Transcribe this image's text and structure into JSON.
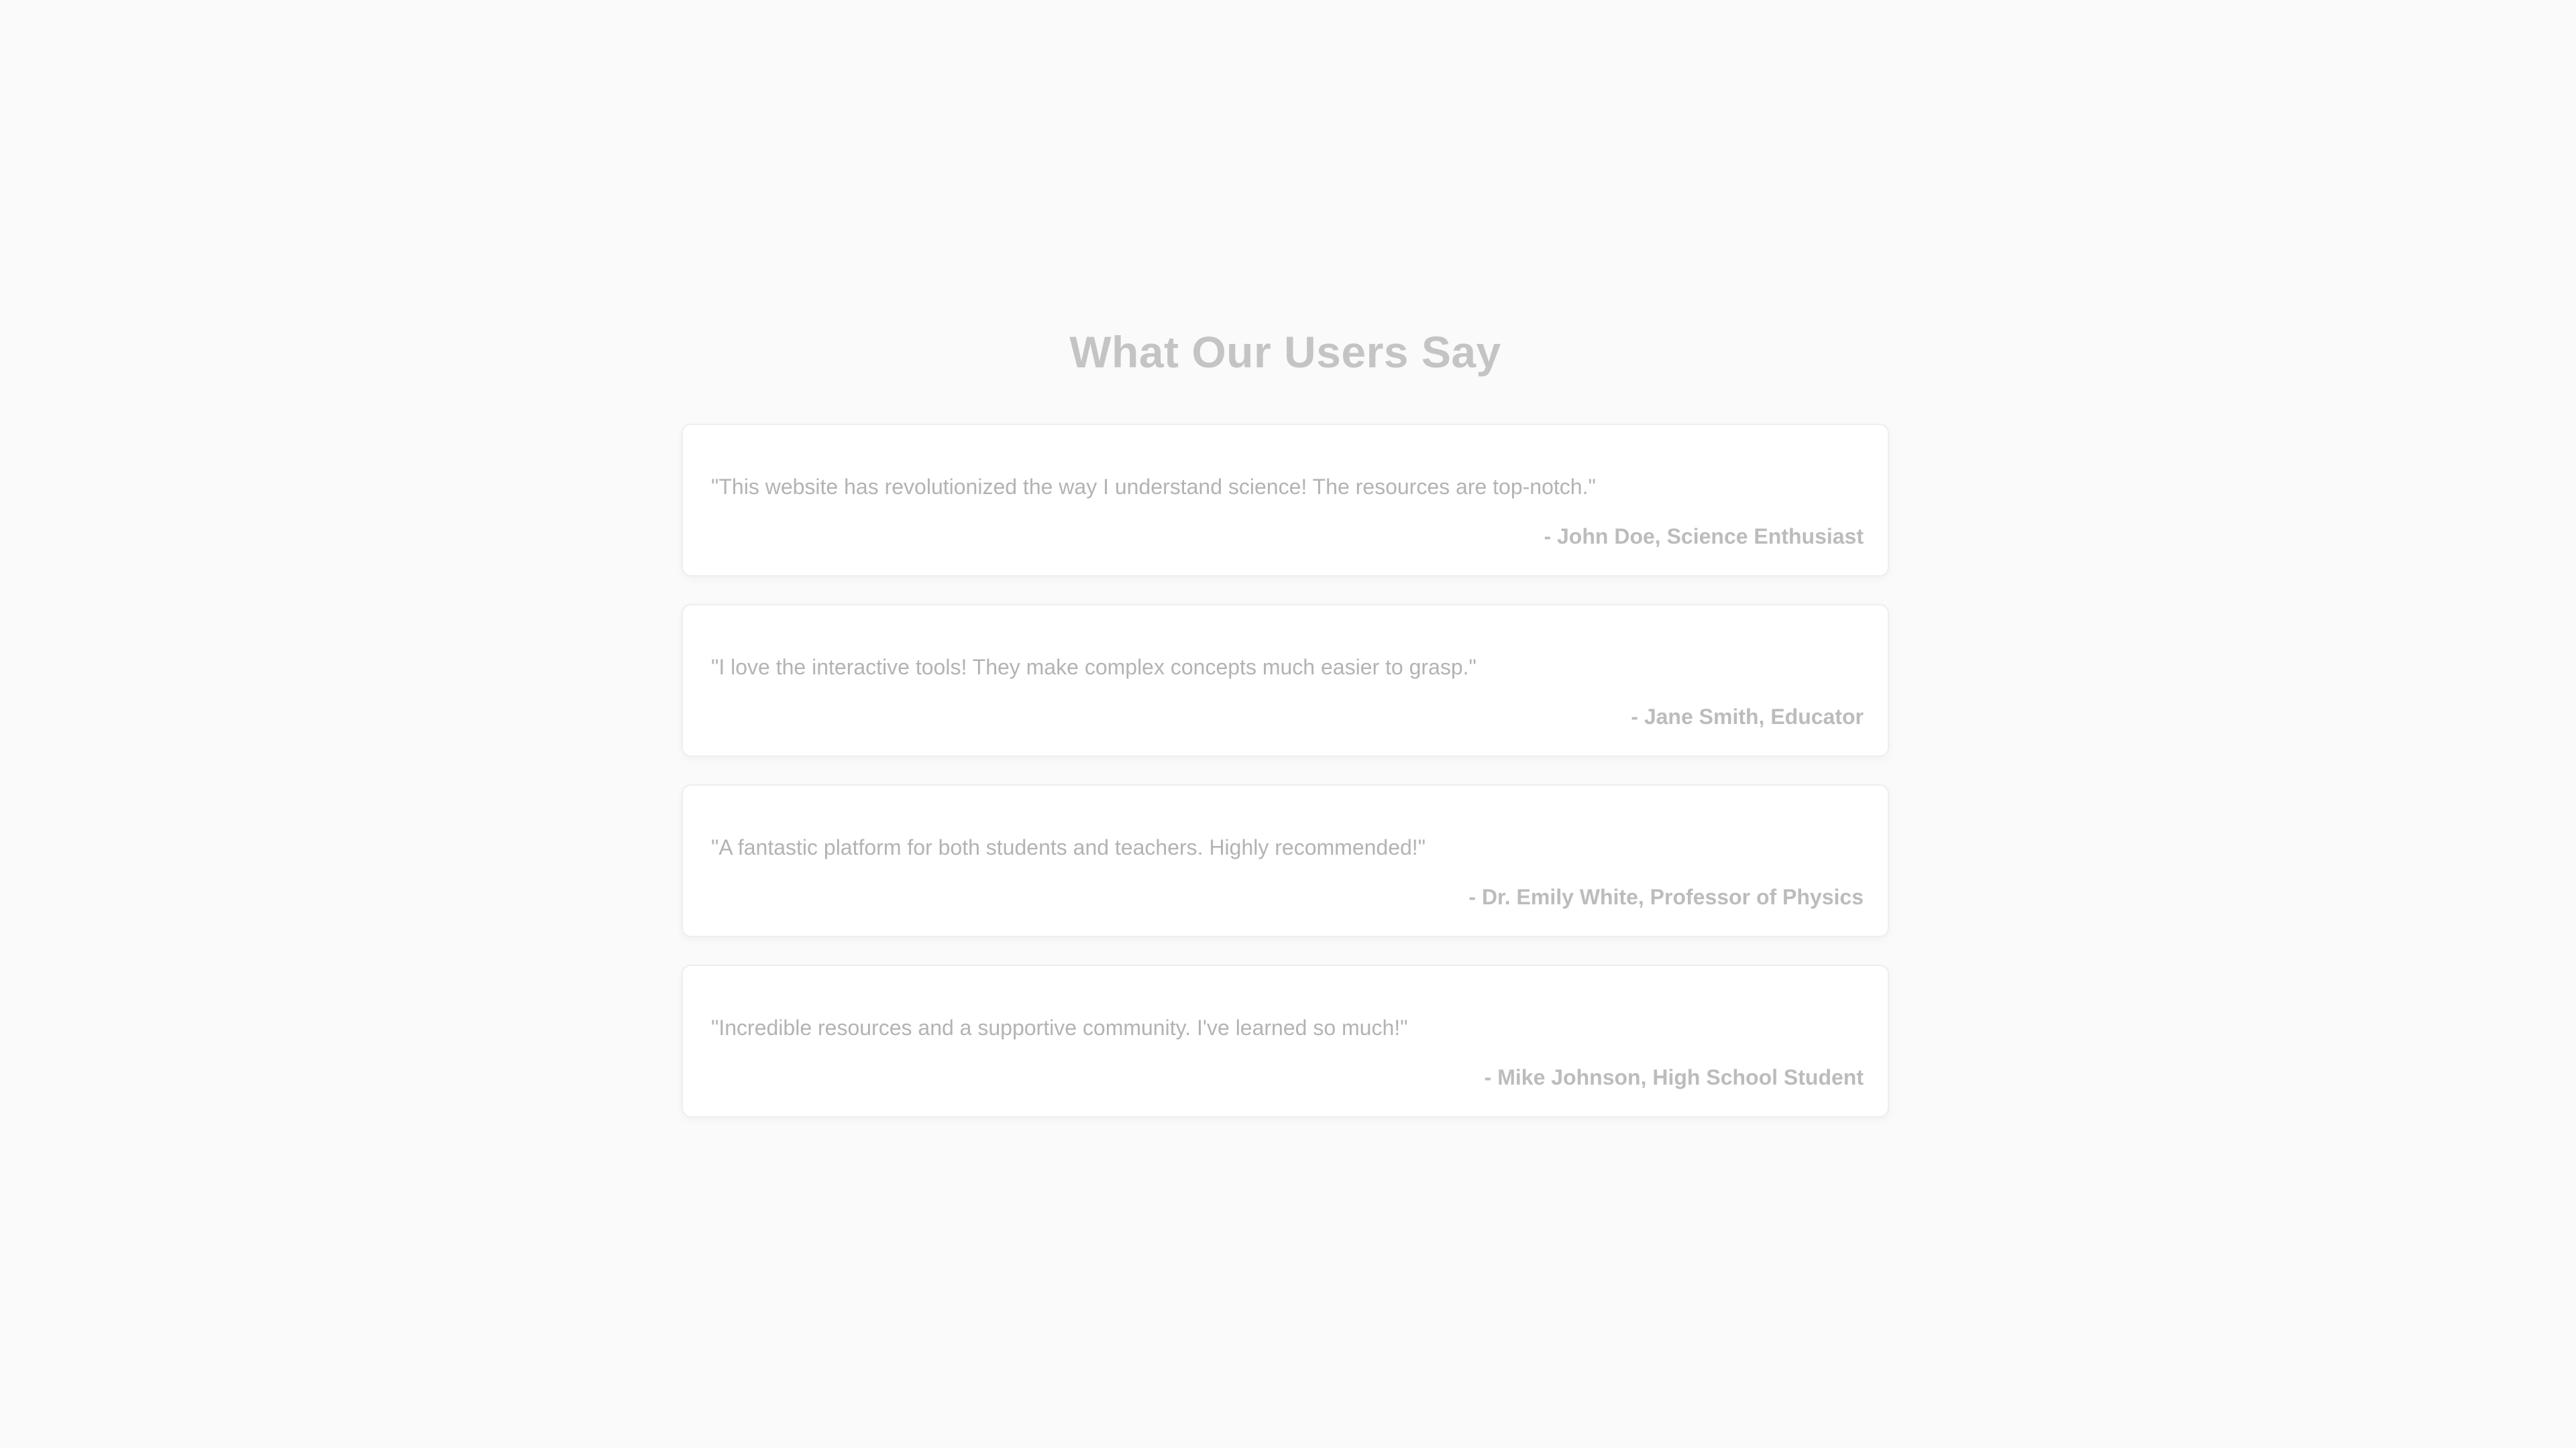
{
  "testimonials_section": {
    "heading": "What Our Users Say",
    "items": [
      {
        "quote": "\"This website has revolutionized the way I understand science! The resources are top-notch.\"",
        "author": "- John Doe, Science Enthusiast"
      },
      {
        "quote": "\"I love the interactive tools! They make complex concepts much easier to grasp.\"",
        "author": "- Jane Smith, Educator"
      },
      {
        "quote": "\"A fantastic platform for both students and teachers. Highly recommended!\"",
        "author": "- Dr. Emily White, Professor of Physics"
      },
      {
        "quote": "\"Incredible resources and a supportive community. I've learned so much!\"",
        "author": "- Mike Johnson, High School Student"
      }
    ]
  },
  "colors": {
    "page_background": "#fafafa",
    "card_background": "#ffffff",
    "heading_text": "#c4c4c4",
    "quote_text": "#b3b3b3",
    "author_text": "#bcbcbc"
  }
}
